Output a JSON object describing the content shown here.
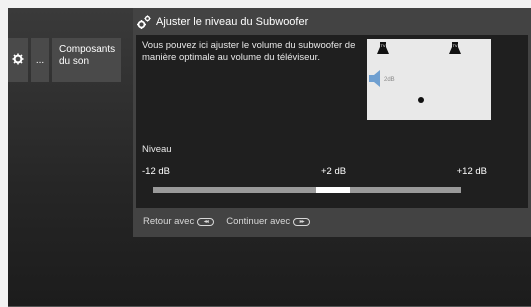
{
  "breadcrumb": {
    "ellipsis": "...",
    "sound_components": "Composants du son"
  },
  "dialog": {
    "title": "Ajuster le niveau du Subwoofer",
    "description": "Vous pouvez ici ajuster le volume du subwoofer de manière optimale au volume du téléviseur.",
    "diagram": {
      "tv_label": "TV",
      "subwoofer_level": "2dB"
    },
    "level": {
      "label": "Niveau",
      "min_label": "-12 dB",
      "current_label": "+2 dB",
      "max_label": "+12 dB",
      "min_db": -12,
      "max_db": 12,
      "current_db": 2
    },
    "footer": {
      "back_label": "Retour avec",
      "continue_label": "Continuer avec"
    }
  },
  "colors": {
    "dialog_bg": "#434343",
    "panel_bg": "#1f1f1f",
    "diagram_bg": "#e9e9e9",
    "subwoofer": "#6f9fd0",
    "slider_track": "#9a9a9a",
    "slider_thumb": "#ffffff"
  }
}
